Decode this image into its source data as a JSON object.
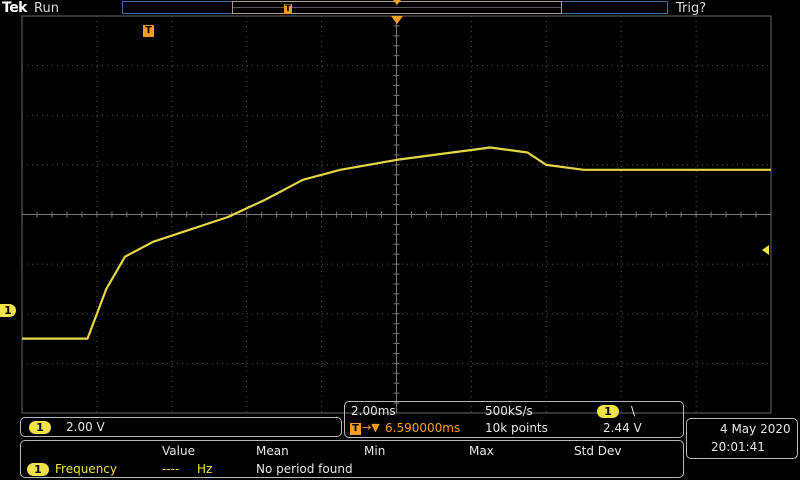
{
  "header": {
    "brand": "Tek",
    "run_state": "Run",
    "trigger_state": "Trig?"
  },
  "colors": {
    "channel1": "#f0e24a",
    "trigger": "#f39c1e",
    "grid": "#555555",
    "record_bar": "#3d6da0"
  },
  "markers": {
    "trigger_marker": "T",
    "channel1_ground": "1"
  },
  "channel": {
    "badge": "1",
    "scale": "2.00 V"
  },
  "timebase": {
    "scale": "2.00ms",
    "sample_rate": "500kS/s",
    "trigger_channel": "1",
    "trigger_slope": "\\",
    "trigger_position_icon": "T",
    "trigger_position_arrow": "→▼",
    "trigger_position": "6.590000ms",
    "record_length": "10k points",
    "trigger_level": "2.44 V"
  },
  "datetime": {
    "date": "4 May 2020",
    "time": "20:01:41"
  },
  "measurement": {
    "headers": [
      "Value",
      "Mean",
      "Min",
      "Max",
      "Std Dev"
    ],
    "row": {
      "channel": "1",
      "name": "Frequency",
      "value": "----",
      "unit": "Hz",
      "status": "No period found"
    }
  },
  "chart_data": {
    "type": "line",
    "x_divisions": 10,
    "y_divisions": 8,
    "x_unit": "ms",
    "y_unit": "V",
    "x_scale_per_div": 2.0,
    "y_scale_per_div": 2.0,
    "xlim": [
      -10,
      10
    ],
    "ylim": [
      -8,
      8
    ],
    "grid": true,
    "series": [
      {
        "points": [
          [
            -10,
            -5.0
          ],
          [
            -8.25,
            -5.0
          ],
          [
            -8.0,
            -4.0
          ],
          [
            -7.75,
            -3.0
          ],
          [
            -7.25,
            -1.7
          ],
          [
            -6.5,
            -1.1
          ],
          [
            -5.5,
            -0.6
          ],
          [
            -4.5,
            -0.1
          ],
          [
            -3.5,
            0.6
          ],
          [
            -2.5,
            1.4
          ],
          [
            -1.5,
            1.8
          ],
          [
            0,
            2.2
          ],
          [
            1.0,
            2.4
          ],
          [
            2.0,
            2.6
          ],
          [
            2.5,
            2.7
          ],
          [
            3.5,
            2.5
          ],
          [
            4.0,
            2.0
          ],
          [
            5.0,
            1.8
          ],
          [
            6.0,
            1.8
          ],
          [
            7.0,
            1.8
          ],
          [
            8.0,
            1.8
          ],
          [
            10,
            1.8
          ]
        ]
      }
    ]
  }
}
